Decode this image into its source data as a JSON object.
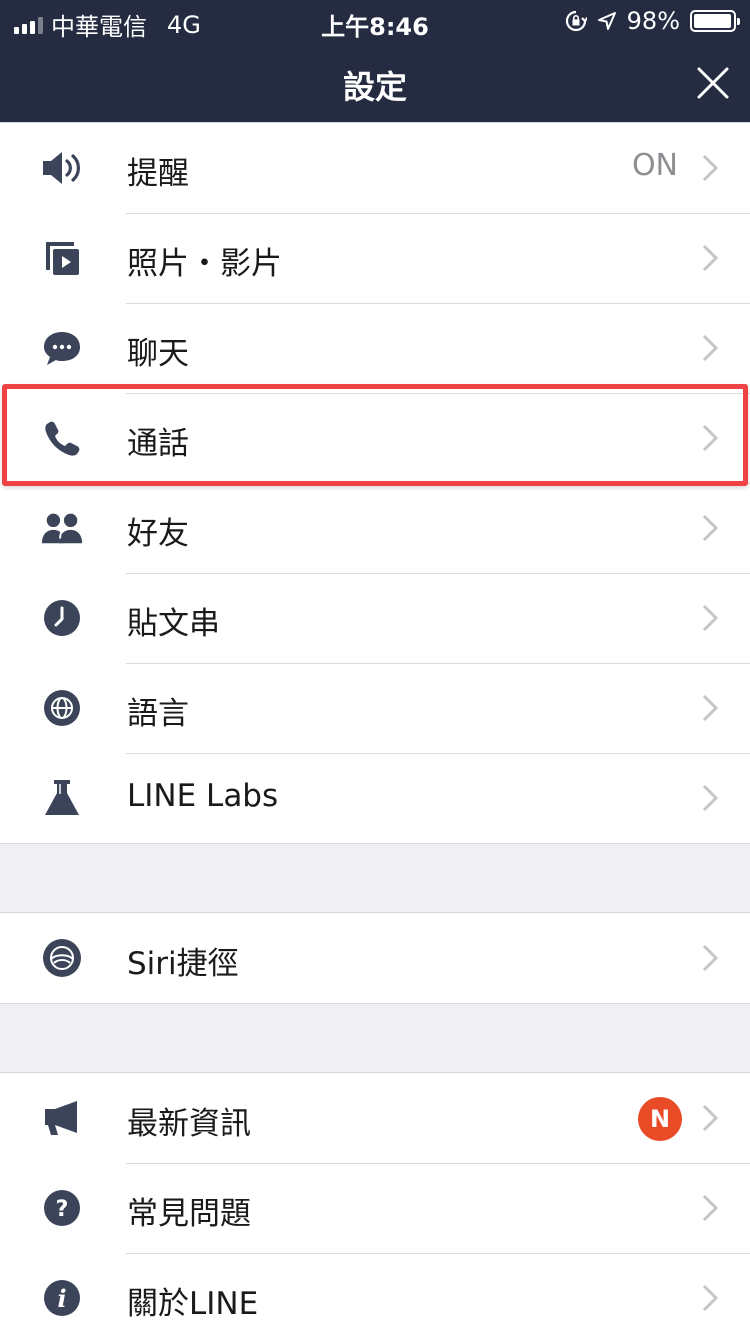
{
  "status_bar": {
    "carrier": "中華電信",
    "network": "4G",
    "time": "上午8:46",
    "battery": "98%",
    "battery_level": 0.98
  },
  "header": {
    "title": "設定",
    "close_icon": "close-icon"
  },
  "colors": {
    "header_bg": "#252c41",
    "icon": "#3b4459",
    "highlight": "#ef4244",
    "badge": "#ea4b27"
  },
  "groups": [
    {
      "items": [
        {
          "label": "提醒",
          "icon": "speaker-icon",
          "value": "ON"
        },
        {
          "label": "照片・影片",
          "icon": "media-icon"
        },
        {
          "label": "聊天",
          "icon": "chat-bubble-icon"
        },
        {
          "label": "通話",
          "icon": "phone-icon"
        },
        {
          "label": "好友",
          "icon": "friends-icon"
        },
        {
          "label": "貼文串",
          "icon": "clock-icon"
        },
        {
          "label": "語言",
          "icon": "globe-icon"
        },
        {
          "label": "LINE Labs",
          "icon": "flask-icon"
        }
      ]
    },
    {
      "items": [
        {
          "label": "Siri捷徑",
          "icon": "siri-icon"
        }
      ]
    },
    {
      "items": [
        {
          "label": "最新資訊",
          "icon": "megaphone-icon",
          "badge": "N"
        },
        {
          "label": "常見問題",
          "icon": "question-icon"
        },
        {
          "label": "關於LINE",
          "icon": "info-icon"
        }
      ]
    }
  ]
}
